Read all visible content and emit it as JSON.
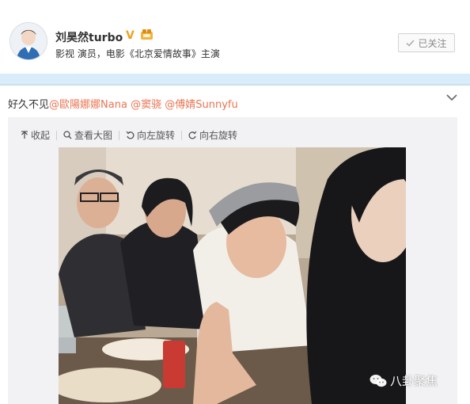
{
  "user": {
    "name": "刘昊然turbo",
    "verified_mark": "V",
    "bio": "影视 演员，电影《北京爱情故事》主演",
    "follow_label": "已关注"
  },
  "post": {
    "text": "好久不见",
    "mentions": [
      "@歐陽娜娜Nana",
      "@窦骁",
      "@傅婧Sunnyfu"
    ]
  },
  "toolbar": {
    "collapse_label": "收起",
    "view_large_label": "查看大图",
    "rotate_left_label": "向左旋转",
    "rotate_right_label": "向右旋转"
  },
  "watermark": {
    "text": "八卦聚焦"
  },
  "icons": {
    "verified": "v-badge-icon",
    "fan": "fan-badge-icon",
    "follow": "check-icon",
    "collapse": "chevron-down-icon",
    "up": "arrow-up-icon",
    "zoom": "magnifier-icon",
    "rotate_left": "rotate-left-icon",
    "rotate_right": "rotate-right-icon",
    "watermark": "wechat-icon"
  },
  "colors": {
    "mention": "#eb7350",
    "band": "#d8ecf9",
    "verified": "#f0a020"
  }
}
